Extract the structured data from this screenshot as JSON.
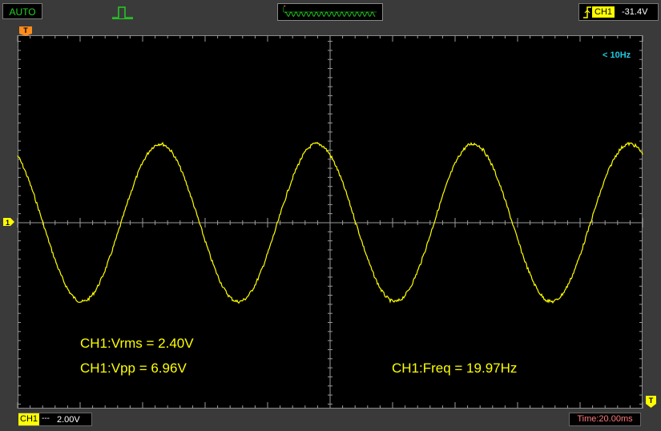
{
  "toolbar": {
    "mode_label": "AUTO",
    "trigger_channel": "CH1",
    "trigger_level": "-31.4V"
  },
  "screen": {
    "freq_note": "< 10Hz",
    "trigger_marker": "T",
    "channel_marker": "1",
    "measurements": {
      "vrms": "CH1:Vrms = 2.40V",
      "vpp": "CH1:Vpp = 6.96V",
      "freq": "CH1:Freq = 19.97Hz"
    }
  },
  "statusbar": {
    "channel": "CH1",
    "coupling": "---",
    "volts_div": "2.00V",
    "time_div": "Time:20.00ms"
  },
  "colors": {
    "waveform": "#ffff00",
    "grid": "#9a9a9a",
    "trigger_marker": "#ff8c1a",
    "mode_text": "#23d023"
  },
  "signal": {
    "frequency_hz": 19.97,
    "vpp": 6.96,
    "vrms": 2.4,
    "volts_per_div": 2.0,
    "time_per_div_ms": 20.0
  }
}
